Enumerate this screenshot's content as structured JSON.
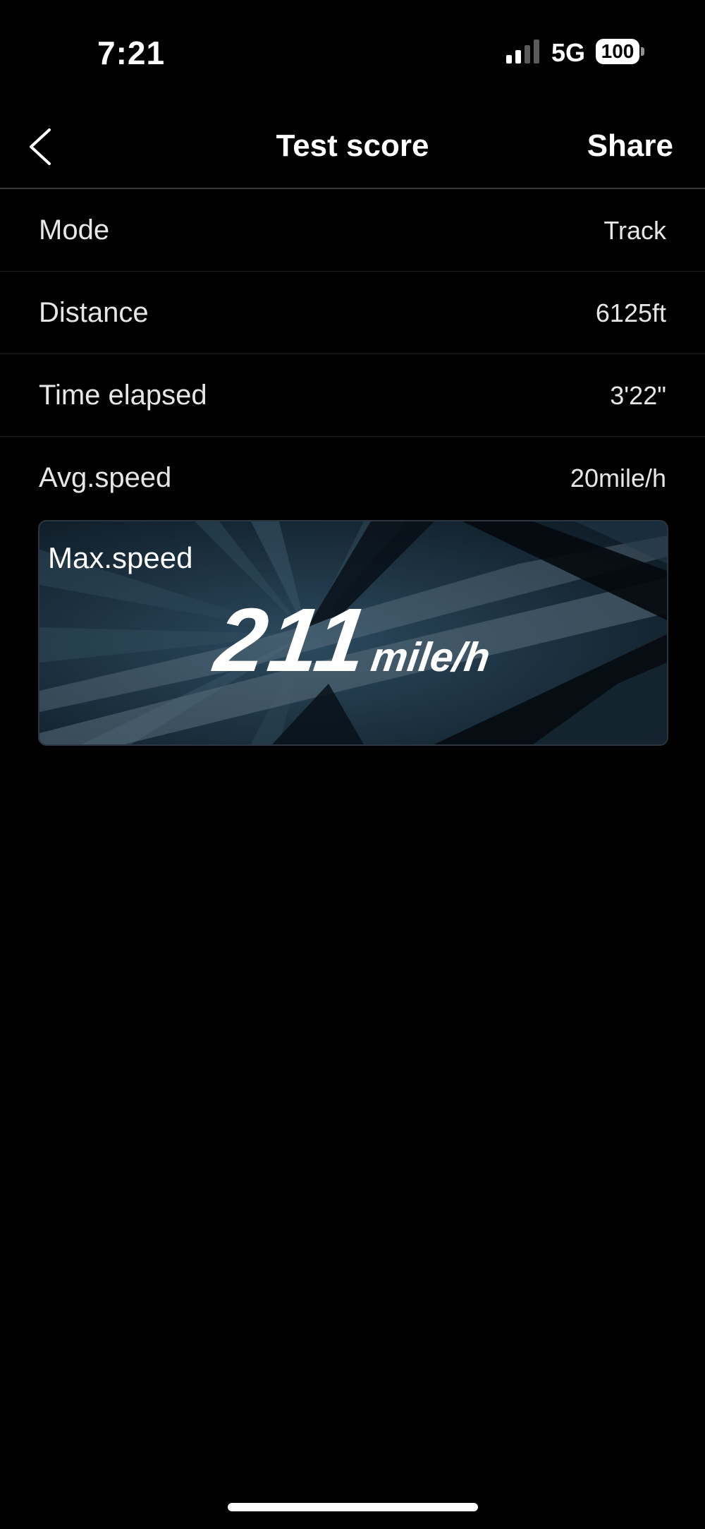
{
  "status_bar": {
    "time": "7:21",
    "network": "5G",
    "battery": "100"
  },
  "nav": {
    "title": "Test score",
    "share_label": "Share"
  },
  "rows": [
    {
      "label": "Mode",
      "value": "Track"
    },
    {
      "label": "Distance",
      "value": "6125ft"
    },
    {
      "label": "Time elapsed",
      "value": "3'22\""
    },
    {
      "label": "Avg.speed",
      "value": "20mile/h"
    }
  ],
  "max_speed": {
    "label": "Max.speed",
    "value": "211",
    "unit": "mile/h"
  },
  "icons": {
    "back": "chevron-left-icon",
    "signal": "cellular-signal-icon",
    "battery": "battery-icon"
  },
  "colors": {
    "background": "#000000",
    "text": "#ffffff",
    "card_base": "#142431"
  }
}
